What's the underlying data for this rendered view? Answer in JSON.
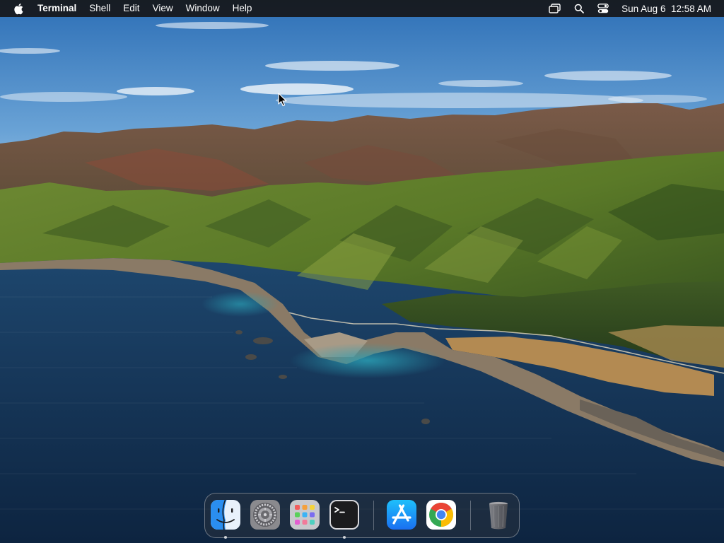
{
  "menubar": {
    "apple_icon": "apple-logo-icon",
    "app_name": "Terminal",
    "menus": [
      "Shell",
      "Edit",
      "View",
      "Window",
      "Help"
    ],
    "status_icons": [
      "screen-mirroring-icon",
      "spotlight-search-icon",
      "control-center-icon"
    ],
    "clock": "Sun Aug 6  12:58 AM"
  },
  "desktop": {
    "wallpaper": "big-sur-coastline",
    "colors": {
      "sky_top": "#2f72b8",
      "sky_horizon": "#b9d4ec",
      "ocean": "#173659",
      "mountain_green": "#5f7f2a"
    }
  },
  "dock": {
    "apps": [
      {
        "name": "Finder",
        "icon": "finder-icon",
        "running": true
      },
      {
        "name": "System Preferences",
        "icon": "system-preferences-icon",
        "running": false
      },
      {
        "name": "Launchpad",
        "icon": "launchpad-icon",
        "running": false
      },
      {
        "name": "Terminal",
        "icon": "terminal-icon",
        "running": true
      },
      {
        "name": "App Store",
        "icon": "app-store-icon",
        "running": false
      },
      {
        "name": "Google Chrome",
        "icon": "chrome-icon",
        "running": false
      },
      {
        "name": "Trash",
        "icon": "trash-icon",
        "running": false
      }
    ]
  }
}
